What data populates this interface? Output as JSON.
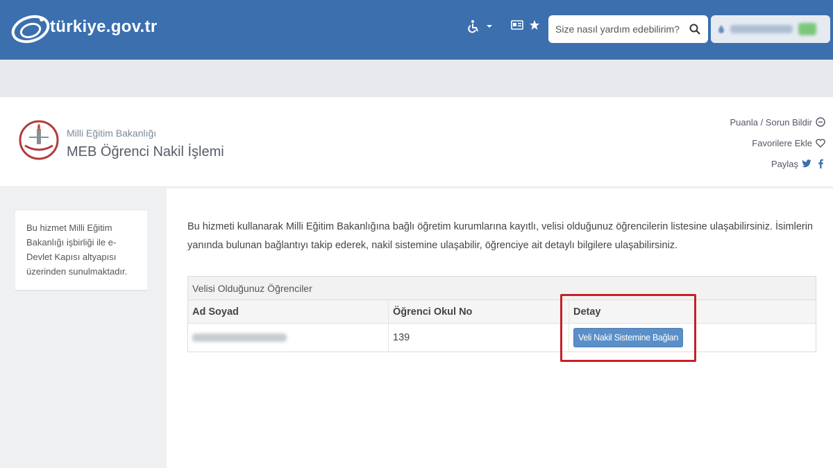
{
  "topbar": {
    "logo_text": "türkiye.gov.tr",
    "search_placeholder": "Size nasıl yardım edebilirim?",
    "colors": {
      "bar": "#3b6fae",
      "accent_red": "#c62028"
    }
  },
  "header": {
    "ministry": "Milli Eğitim Bakanlığı",
    "service_title": "MEB Öğrenci Nakil İşlemi",
    "links": {
      "rate": "Puanla / Sorun Bildir",
      "favorites": "Favorilere Ekle",
      "share": "Paylaş"
    }
  },
  "sidebar": {
    "info": "Bu hizmet Milli Eğitim Bakanlığı işbirliği ile e-Devlet Kapısı altyapısı üzerinden sunulmaktadır."
  },
  "main": {
    "intro": "Bu hizmeti kullanarak Milli Eğitim Bakanlığına bağlı öğretim kurumlarına kayıtlı, velisi olduğunuz öğrencilerin listesine ulaşabilirsiniz. İsimlerin yanında bulunan bağlantıyı takip ederek, nakil sistemine ulaşabilir, öğrenciye ait detaylı bilgilere ulaşabilirsiniz.",
    "table": {
      "caption": "Velisi Olduğunuz Öğrenciler",
      "headers": [
        "Ad Soyad",
        "Öğrenci Okul No",
        "Detay"
      ],
      "rows": [
        {
          "school_no": "139",
          "button": "Veli Nakil Sistemine Bağlan"
        }
      ]
    }
  }
}
